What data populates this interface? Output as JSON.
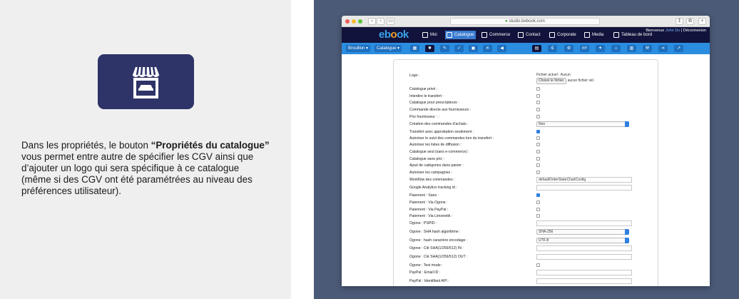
{
  "description": {
    "part1": "Dans les propriétés, le bouton ",
    "bold": "“Propriétés du catalogue”",
    "part2": " vous permet entre autre de spécifier les CGV ainsi que d’ajouter un logo qui sera spécifique à ce catalogue (même si des CGV ont été paramétrées au niveau des préférences utilisateur)."
  },
  "colors": {
    "tile_bg": "#2e3468",
    "right_panel_bg": "#4b5a77",
    "app_bar_bg": "#12133c",
    "toolbar_bg": "#2b8de0",
    "active_nav": "#3a7cd0"
  },
  "browser": {
    "url": "studio.bebook.com",
    "nav_buttons": [
      "‹",
      "›",
      "▭"
    ],
    "right_buttons": [
      "↥",
      "⧉",
      "+"
    ]
  },
  "app": {
    "logo_prefix": "eb",
    "logo_o": "o",
    "logo_suffix": "ok",
    "nav": [
      {
        "label": "Moi",
        "icon": "user-icon"
      },
      {
        "label": "Catalogue",
        "icon": "store-icon",
        "active": true
      },
      {
        "label": "Commerce",
        "icon": "cart-icon"
      },
      {
        "label": "Contact",
        "icon": "contact-icon"
      },
      {
        "label": "Corporate",
        "icon": "corporate-icon"
      },
      {
        "label": "Media",
        "icon": "media-icon"
      },
      {
        "label": "Tableau de bord",
        "icon": "dashboard-icon"
      }
    ],
    "user_line1_prefix": "Bienvenue",
    "user_name": "John Do",
    "user_sep": "|",
    "logout": "Déconnexion"
  },
  "toolbar": {
    "draft_select": "Brouillon",
    "catalog_select": "Catalogue",
    "icons": [
      "catalog-icon",
      "gear-icon",
      "edit-icon",
      "check-icon",
      "image-icon",
      "tools-icon",
      "megaphone-icon",
      "page-icon",
      "euro-icon",
      "settings-icon",
      "area-icon",
      "twitter-icon",
      "basket-icon",
      "pdf-icon",
      "wrench-icon",
      "share-icon",
      "export-icon"
    ],
    "m2_label": "m²"
  },
  "form": {
    "logo": {
      "label": "Logo :",
      "current": "Fichier actuel : Aucun",
      "choose_btn": "Choisir le fichier",
      "no_file": "aucun fichier sél."
    },
    "rows": [
      {
        "label": "Catalogue privé :",
        "type": "checkbox",
        "checked": false
      },
      {
        "label": "Interdire le transfert :",
        "type": "checkbox",
        "checked": false
      },
      {
        "label": "Catalogue pour prescripteurs :",
        "type": "checkbox",
        "checked": false
      },
      {
        "label": "Commande directe aux fournisseurs :",
        "type": "checkbox",
        "checked": false
      },
      {
        "label": "Prix fournisseur : :",
        "type": "checkbox",
        "checked": false
      },
      {
        "label": "Création des commandes d'achats :",
        "type": "select",
        "value": "Non"
      },
      {
        "label": "Transfert avec approbation seulement :",
        "type": "checkbox",
        "checked": true
      },
      {
        "label": "Autoriser le suivi des commandes lors du transfert :",
        "type": "checkbox",
        "checked": false
      },
      {
        "label": "Autoriser les listes de diffusion :",
        "type": "checkbox",
        "checked": false
      },
      {
        "label": "Catalogue seul (sans e-commerce) :",
        "type": "checkbox",
        "checked": false
      },
      {
        "label": "Catalogue sans prix :",
        "type": "checkbox",
        "checked": false
      },
      {
        "label": "Ajout de catégories dans panier :",
        "type": "checkbox",
        "checked": false
      },
      {
        "label": "Autoriser les campagnes :",
        "type": "checkbox",
        "checked": false
      },
      {
        "label": "Workflow des commandes :",
        "type": "text",
        "value": "defaultOrderStateChartConfig"
      },
      {
        "label": "Google Analytics tracking id :",
        "type": "text",
        "value": ""
      },
      {
        "label": "Paiement : Sans :",
        "type": "checkbox",
        "checked": true
      },
      {
        "label": "Paiement : Via Ogone :",
        "type": "checkbox",
        "checked": false
      },
      {
        "label": "Paiement : Via PayPal :",
        "type": "checkbox",
        "checked": false
      },
      {
        "label": "Paiement : Via Limonetik :",
        "type": "checkbox",
        "checked": false
      },
      {
        "label": "Ogone : PSPID :",
        "type": "text",
        "value": ""
      },
      {
        "label": "Ogone : SHA hash algorithme :",
        "type": "select",
        "value": "SHA-256"
      },
      {
        "label": "Ogone : hash caractère encodage :",
        "type": "select",
        "value": "UTF-8"
      },
      {
        "label": "Ogone : Clé SHA(1/256/512) IN :",
        "type": "text",
        "value": ""
      },
      {
        "label": "Ogone : Clé SHA(1/256/512) OUT :",
        "type": "text",
        "value": ""
      },
      {
        "label": "Ogone : Test mode :",
        "type": "checkbox",
        "checked": false
      },
      {
        "label": "PayPal : Email ID :",
        "type": "text",
        "value": ""
      },
      {
        "label": "PayPal : Identifiant API :",
        "type": "text",
        "value": ""
      }
    ]
  }
}
